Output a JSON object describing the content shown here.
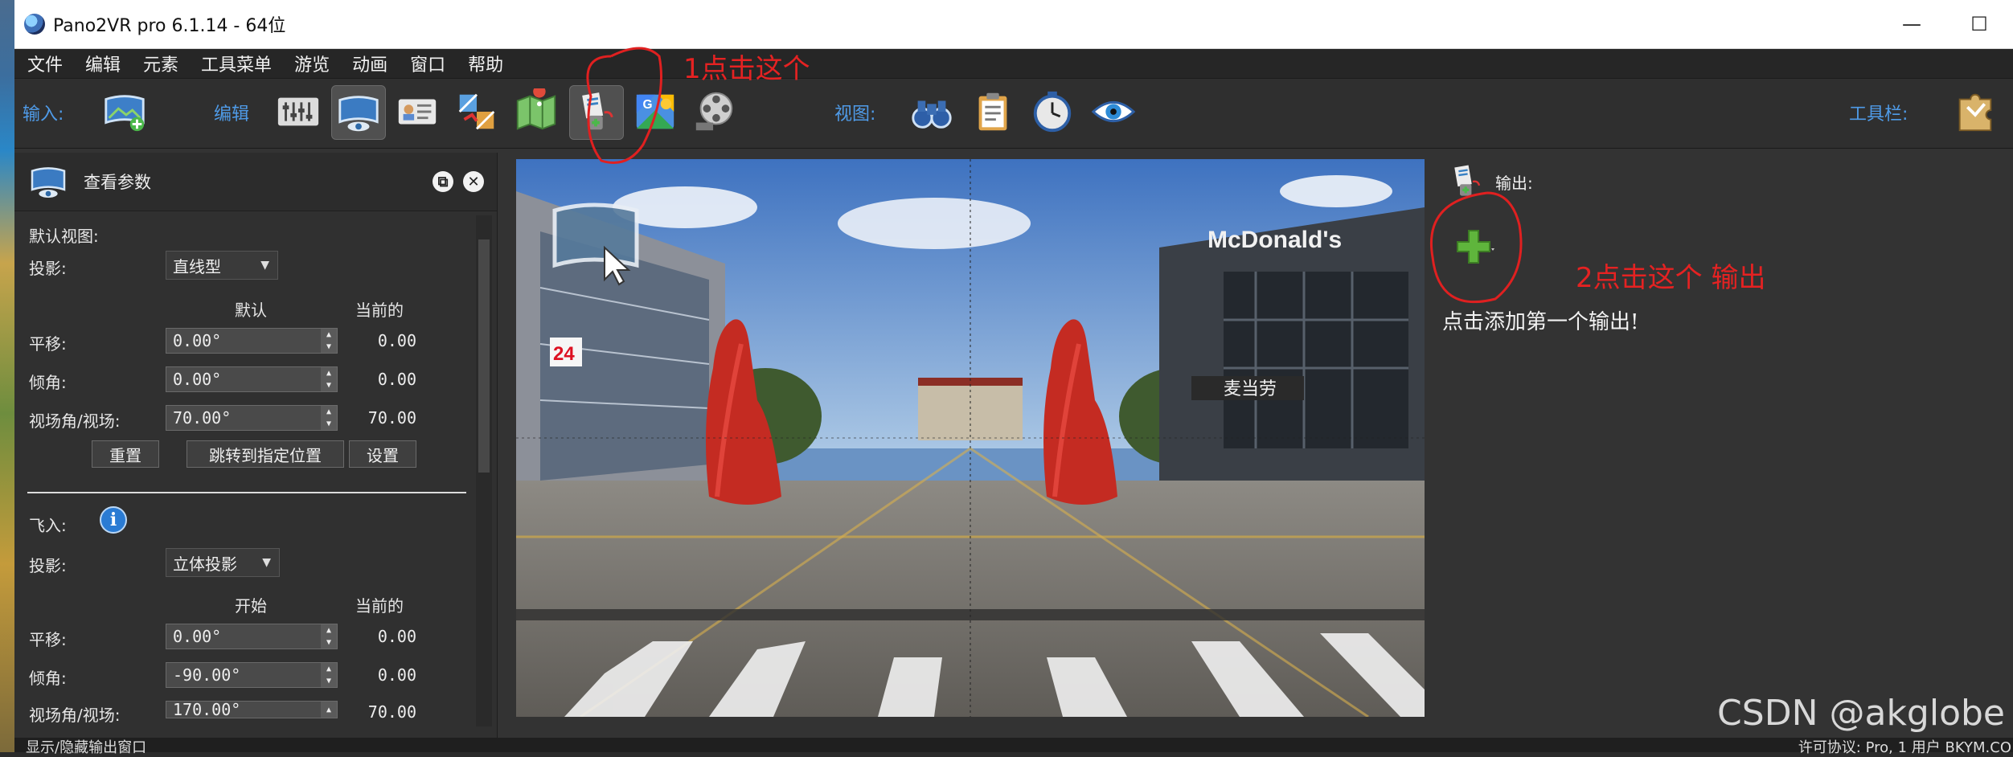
{
  "window": {
    "title": "Pano2VR pro 6.1.14 - 64位",
    "minimize": "—",
    "maximize": "☐"
  },
  "menu": [
    "文件",
    "编辑",
    "元素",
    "工具菜单",
    "游览",
    "动画",
    "窗口",
    "帮助"
  ],
  "toolbar": {
    "input_label": "输入:",
    "edit_label": "编辑",
    "view_label": "视图:",
    "tools_label": "工具栏:",
    "icons": {
      "input": "add-panorama-icon",
      "edit": [
        "sliders-icon",
        "viewing-params-icon",
        "properties-card-icon",
        "patch-icon",
        "map-icon",
        "output-icon",
        "google-street-view-icon",
        "animation-film-icon"
      ],
      "view": [
        "binoculars-icon",
        "clipboard-icon",
        "clock-icon",
        "eye-icon"
      ],
      "tools": "puzzle-icon"
    }
  },
  "left_panel": {
    "title": "查看参数",
    "default_view_label": "默认视图:",
    "projection_label": "投影:",
    "projection_value": "直线型",
    "col_default": "默认",
    "col_current": "当前的",
    "pan_label": "平移:",
    "pan_value": "0.00°",
    "pan_current": "0.00",
    "tilt_label": "倾角:",
    "tilt_value": "0.00°",
    "tilt_current": "0.00",
    "fov_label": "视场角/视场:",
    "fov_value": "70.00°",
    "fov_current": "70.00",
    "btn_reset": "重置",
    "btn_jump": "跳转到指定位置",
    "btn_set": "设置",
    "fly_in_label": "飞入:",
    "fly_projection_label": "投影:",
    "fly_projection_value": "立体投影",
    "col_start": "开始",
    "col_current2": "当前的",
    "fly_pan_label": "平移:",
    "fly_pan_value": "0.00°",
    "fly_pan_current": "0.00",
    "fly_tilt_label": "倾角:",
    "fly_tilt_value": "-90.00°",
    "fly_tilt_current": "0.00",
    "fly_fov_label": "视场角/视场:",
    "fly_fov_value": "170.00°",
    "fly_fov_current": "70.00"
  },
  "viewer": {
    "store_sign_en": "McDonald's",
    "store_sign_cn": "麦当劳",
    "shop_number": "24"
  },
  "right_panel": {
    "title": "输出:",
    "add_hint": "点击添加第一个输出!"
  },
  "annotations": {
    "step1": "1点击这个",
    "step2": "2点击这个 输出"
  },
  "status": {
    "left": "显示/隐藏输出窗口",
    "right": "许可协议: Pro, 1 用户 BKYM.CO"
  },
  "watermark": "CSDN @akglobe"
}
